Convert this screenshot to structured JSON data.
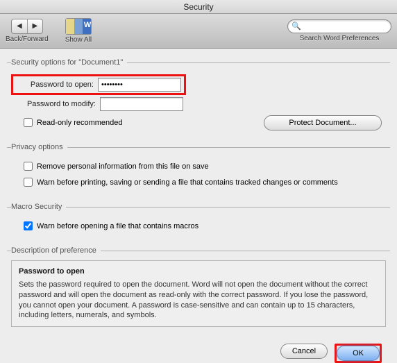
{
  "window": {
    "title": "Security"
  },
  "toolbar": {
    "back_forward_label": "Back/Forward",
    "show_all_label": "Show All",
    "search_placeholder": "",
    "search_label": "Search Word Preferences"
  },
  "security_options": {
    "legend": "Security options for \"Document1\"",
    "password_open_label": "Password to open:",
    "password_open_value": "••••••••",
    "password_modify_label": "Password to modify:",
    "password_modify_value": "",
    "readonly_label": "Read-only recommended",
    "protect_button": "Protect Document..."
  },
  "privacy": {
    "legend": "Privacy options",
    "remove_personal_label": "Remove personal information from this file on save",
    "warn_print_label": "Warn before printing, saving or sending a file that contains tracked changes or comments"
  },
  "macro": {
    "legend": "Macro Security",
    "warn_macros_label": "Warn before opening a file that contains macros"
  },
  "description": {
    "legend": "Description of preference",
    "title": "Password to open",
    "body": "Sets the password required to open the document. Word will not open the document without the correct password and will open the document as read-only with the correct password. If you lose the password, you cannot open your document. A password is case-sensitive and can contain up to 15 characters, including letters, numerals, and symbols."
  },
  "footer": {
    "cancel": "Cancel",
    "ok": "OK"
  }
}
